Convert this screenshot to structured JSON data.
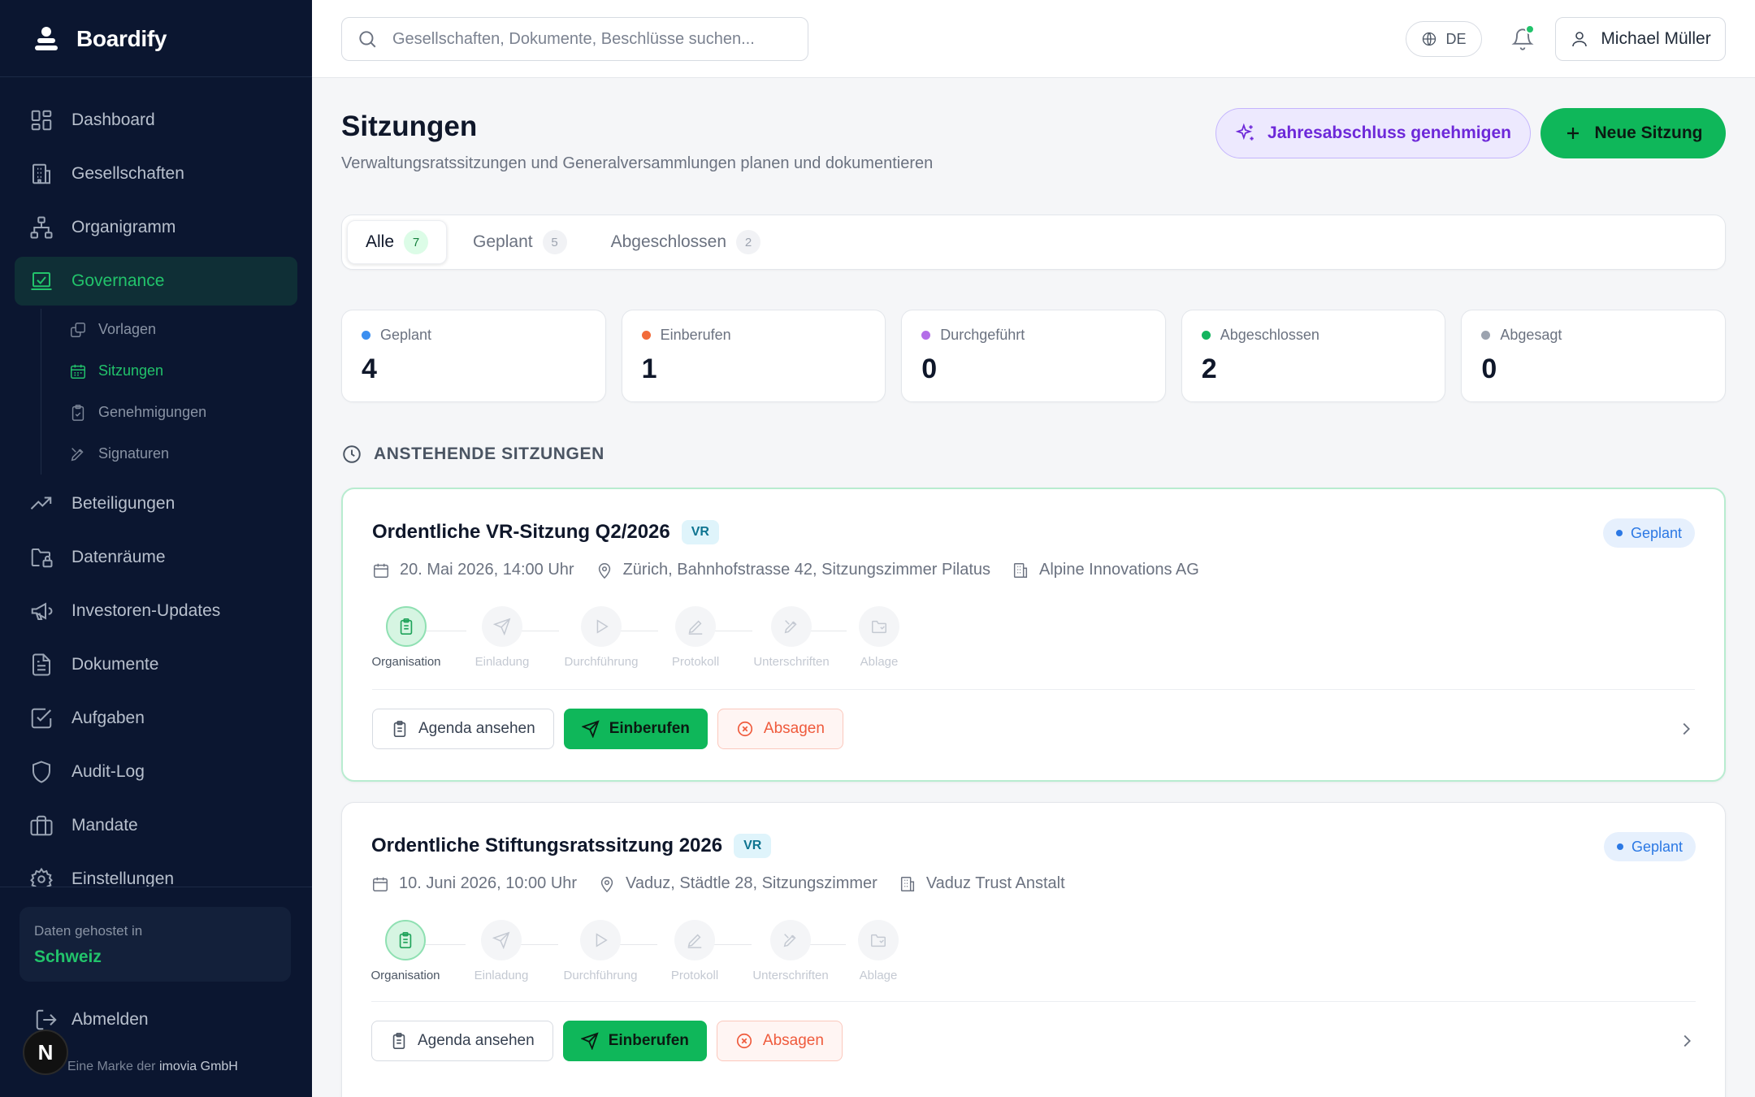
{
  "brand": {
    "name": "Boardify"
  },
  "sidebar": {
    "items": [
      {
        "label": "Dashboard",
        "icon": "dashboard-icon"
      },
      {
        "label": "Gesellschaften",
        "icon": "building-icon"
      },
      {
        "label": "Organigramm",
        "icon": "org-chart-icon"
      },
      {
        "label": "Governance",
        "icon": "governance-icon",
        "active": true
      },
      {
        "label": "Beteiligungen",
        "icon": "trending-up-icon"
      },
      {
        "label": "Datenräume",
        "icon": "folder-lock-icon"
      },
      {
        "label": "Investoren-Updates",
        "icon": "megaphone-icon"
      },
      {
        "label": "Dokumente",
        "icon": "document-icon"
      },
      {
        "label": "Aufgaben",
        "icon": "checkbox-icon"
      },
      {
        "label": "Audit-Log",
        "icon": "shield-icon"
      },
      {
        "label": "Mandate",
        "icon": "briefcase-icon"
      },
      {
        "label": "Einstellungen",
        "icon": "gear-icon"
      }
    ],
    "subitems": [
      {
        "label": "Vorlagen",
        "icon": "copy-icon"
      },
      {
        "label": "Sitzungen",
        "icon": "calendar-icon",
        "active": true
      },
      {
        "label": "Genehmigungen",
        "icon": "clipboard-check-icon"
      },
      {
        "label": "Signaturen",
        "icon": "pen-icon"
      }
    ],
    "host": {
      "label": "Daten gehostet in",
      "value": "Schweiz"
    },
    "logout": "Abmelden",
    "footer_prefix": "Eine Marke der",
    "footer_company": "imovia GmbH",
    "badge": "N"
  },
  "topbar": {
    "search_placeholder": "Gesellschaften, Dokumente, Beschlüsse suchen...",
    "language": "DE",
    "user": "Michael Müller"
  },
  "page": {
    "title": "Sitzungen",
    "subtitle": "Verwaltungsratssitzungen und Generalversammlungen planen und dokumentieren",
    "approve_label": "Jahresabschluss genehmigen",
    "new_label": "Neue Sitzung"
  },
  "tabs": [
    {
      "label": "Alle",
      "count": "7",
      "active": true
    },
    {
      "label": "Geplant",
      "count": "5"
    },
    {
      "label": "Abgeschlossen",
      "count": "2"
    }
  ],
  "stats": [
    {
      "label": "Geplant",
      "value": "4",
      "color": "#3b8ff0"
    },
    {
      "label": "Einberufen",
      "value": "1",
      "color": "#f26b3a"
    },
    {
      "label": "Durchgeführt",
      "value": "0",
      "color": "#b46ee8"
    },
    {
      "label": "Abgeschlossen",
      "value": "2",
      "color": "#14b45e"
    },
    {
      "label": "Abgesagt",
      "value": "0",
      "color": "#9ca3af"
    }
  ],
  "section": {
    "title": "ANSTEHENDE SITZUNGEN"
  },
  "steps": [
    "Organisation",
    "Einladung",
    "Durchführung",
    "Protokoll",
    "Unterschriften",
    "Ablage"
  ],
  "meetings": [
    {
      "title": "Ordentliche VR-Sitzung Q2/2026",
      "tag": "VR",
      "status": "Geplant",
      "date": "20. Mai 2026, 14:00 Uhr",
      "location": "Zürich, Bahnhofstrasse 42, Sitzungszimmer Pilatus",
      "company": "Alpine Innovations AG"
    },
    {
      "title": "Ordentliche Stiftungsratssitzung 2026",
      "tag": "VR",
      "status": "Geplant",
      "date": "10. Juni 2026, 10:00 Uhr",
      "location": "Vaduz, Städtle 28, Sitzungszimmer",
      "company": "Vaduz Trust Anstalt"
    }
  ],
  "actions": {
    "agenda": "Agenda ansehen",
    "convene": "Einberufen",
    "cancel": "Absagen"
  }
}
